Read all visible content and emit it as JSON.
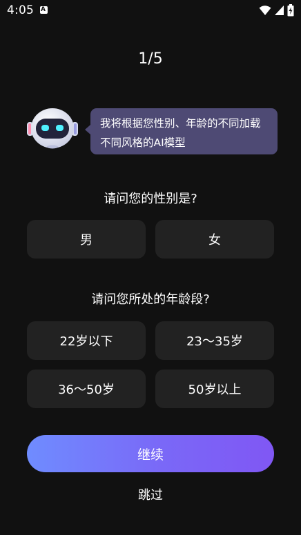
{
  "status_bar": {
    "time": "4:05",
    "notification_icon_letter": "A"
  },
  "progress": "1/5",
  "assistant": {
    "bubble_line1": "我将根据您性别、年龄的不同加载",
    "bubble_line2": "不同风格的AI模型"
  },
  "gender_question": {
    "label": "请问您的性别是?",
    "options": [
      "男",
      "女"
    ]
  },
  "age_question": {
    "label": "请问您所处的年龄段?",
    "options": [
      "22岁以下",
      "23～35岁",
      "36～50岁",
      "50岁以上"
    ]
  },
  "continue_label": "继续",
  "skip_label": "跳过",
  "colors": {
    "background": "#111111",
    "option_bg": "#222222",
    "bubble_bg": "#4e4a74",
    "button_gradient_start": "#6f8cff",
    "button_gradient_end": "#8057f4",
    "robot_eye": "#4ff0ff"
  }
}
